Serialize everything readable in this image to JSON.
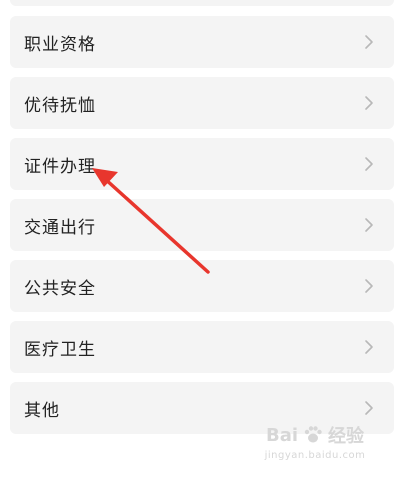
{
  "menu": {
    "items": [
      {
        "id": "top-partial",
        "label": ""
      },
      {
        "id": "vocational-qualification",
        "label": "职业资格"
      },
      {
        "id": "preferential-treatment",
        "label": "优待抚恤"
      },
      {
        "id": "certificate-handling",
        "label": "证件办理"
      },
      {
        "id": "transportation",
        "label": "交通出行"
      },
      {
        "id": "public-safety",
        "label": "公共安全"
      },
      {
        "id": "medical-health",
        "label": "医疗卫生"
      },
      {
        "id": "others",
        "label": "其他"
      }
    ]
  },
  "annotation": {
    "arrow_color": "#e8362d",
    "target": "certificate-handling"
  },
  "watermark": {
    "brand": "Bai",
    "brand_suffix": "经验",
    "url": "jingyan.baidu.com"
  },
  "icons": {
    "chevron": "chevron-right-icon"
  },
  "colors": {
    "card_bg": "#f4f4f4",
    "text": "#222222",
    "chevron": "#b8b8b8",
    "watermark": "#d7d7d7"
  }
}
